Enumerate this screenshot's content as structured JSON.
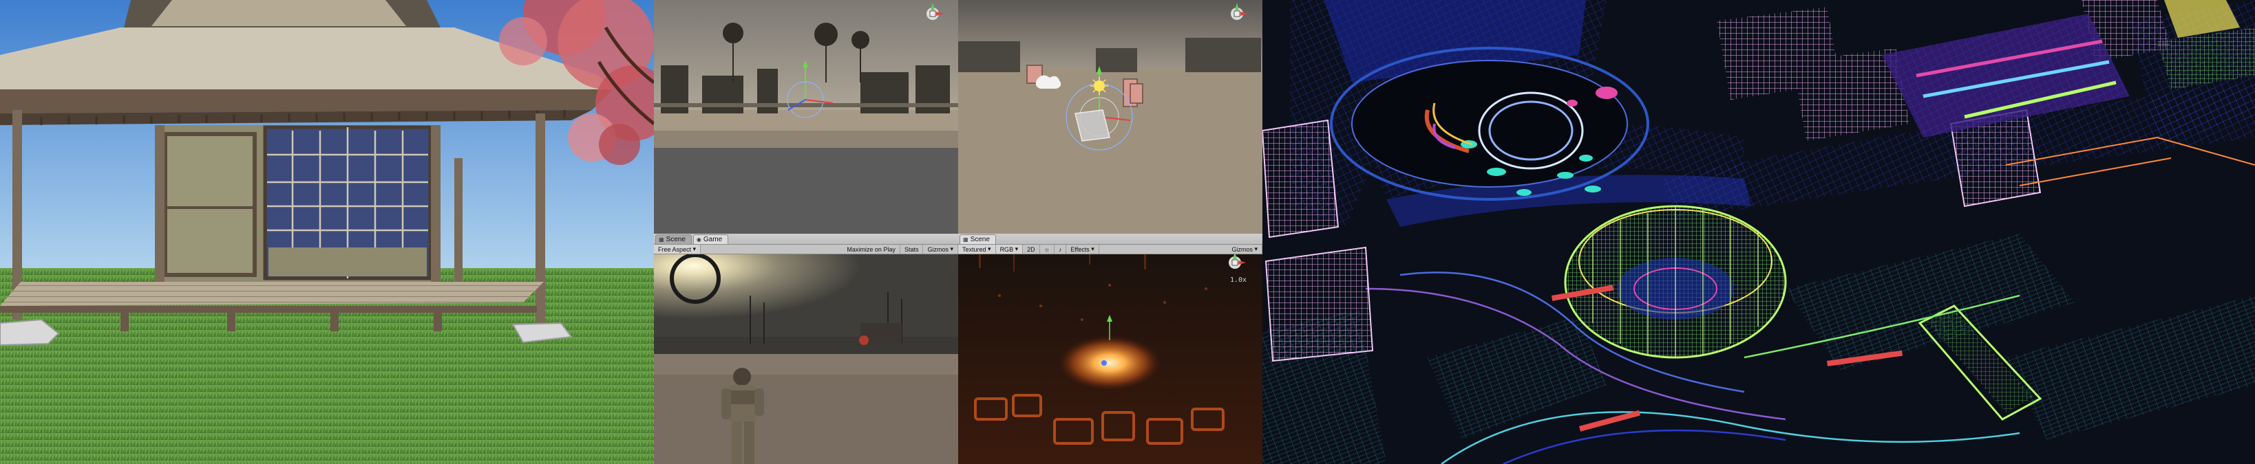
{
  "panels": {
    "pavilion": {
      "name": "japanese-pavilion-scene"
    },
    "desert_scene": {
      "name": "desert-scene-view"
    },
    "camp_scene": {
      "name": "camp-scene-view"
    },
    "game": {
      "tabs": [
        {
          "label": "Scene",
          "icon": "grid-icon"
        },
        {
          "label": "Game",
          "icon": "gamepad-icon"
        }
      ],
      "toolbar": {
        "display": "Free Aspect",
        "maximize": "Maximize on Play",
        "stats": "Stats",
        "gizmos": "Gizmos"
      }
    },
    "glow_scene": {
      "tabs": [
        {
          "label": "Scene",
          "icon": "grid-icon"
        }
      ],
      "toolbar": {
        "shading": "Textured",
        "render_mode": "RGB",
        "toggle_2d": "2D",
        "effects": "Effects",
        "gizmos": "Gizmos"
      },
      "scale_readout": "1.0x"
    },
    "wireframe": {
      "name": "wireframe-city-model"
    }
  },
  "colors": {
    "sky_top": "#3f7fcf",
    "sky_bottom": "#a9cdea",
    "grass": "#5f9a3e",
    "wood": "#6a5848",
    "blossom": "#c8545c",
    "desert_ground": "#9a8e7e",
    "glow_core": "#ff9a3c",
    "wire_bg": "#0b0f19",
    "wire_blue": "#2b3ccf",
    "wire_pink": "#e7a9ef",
    "wire_green": "#7fe86a"
  }
}
